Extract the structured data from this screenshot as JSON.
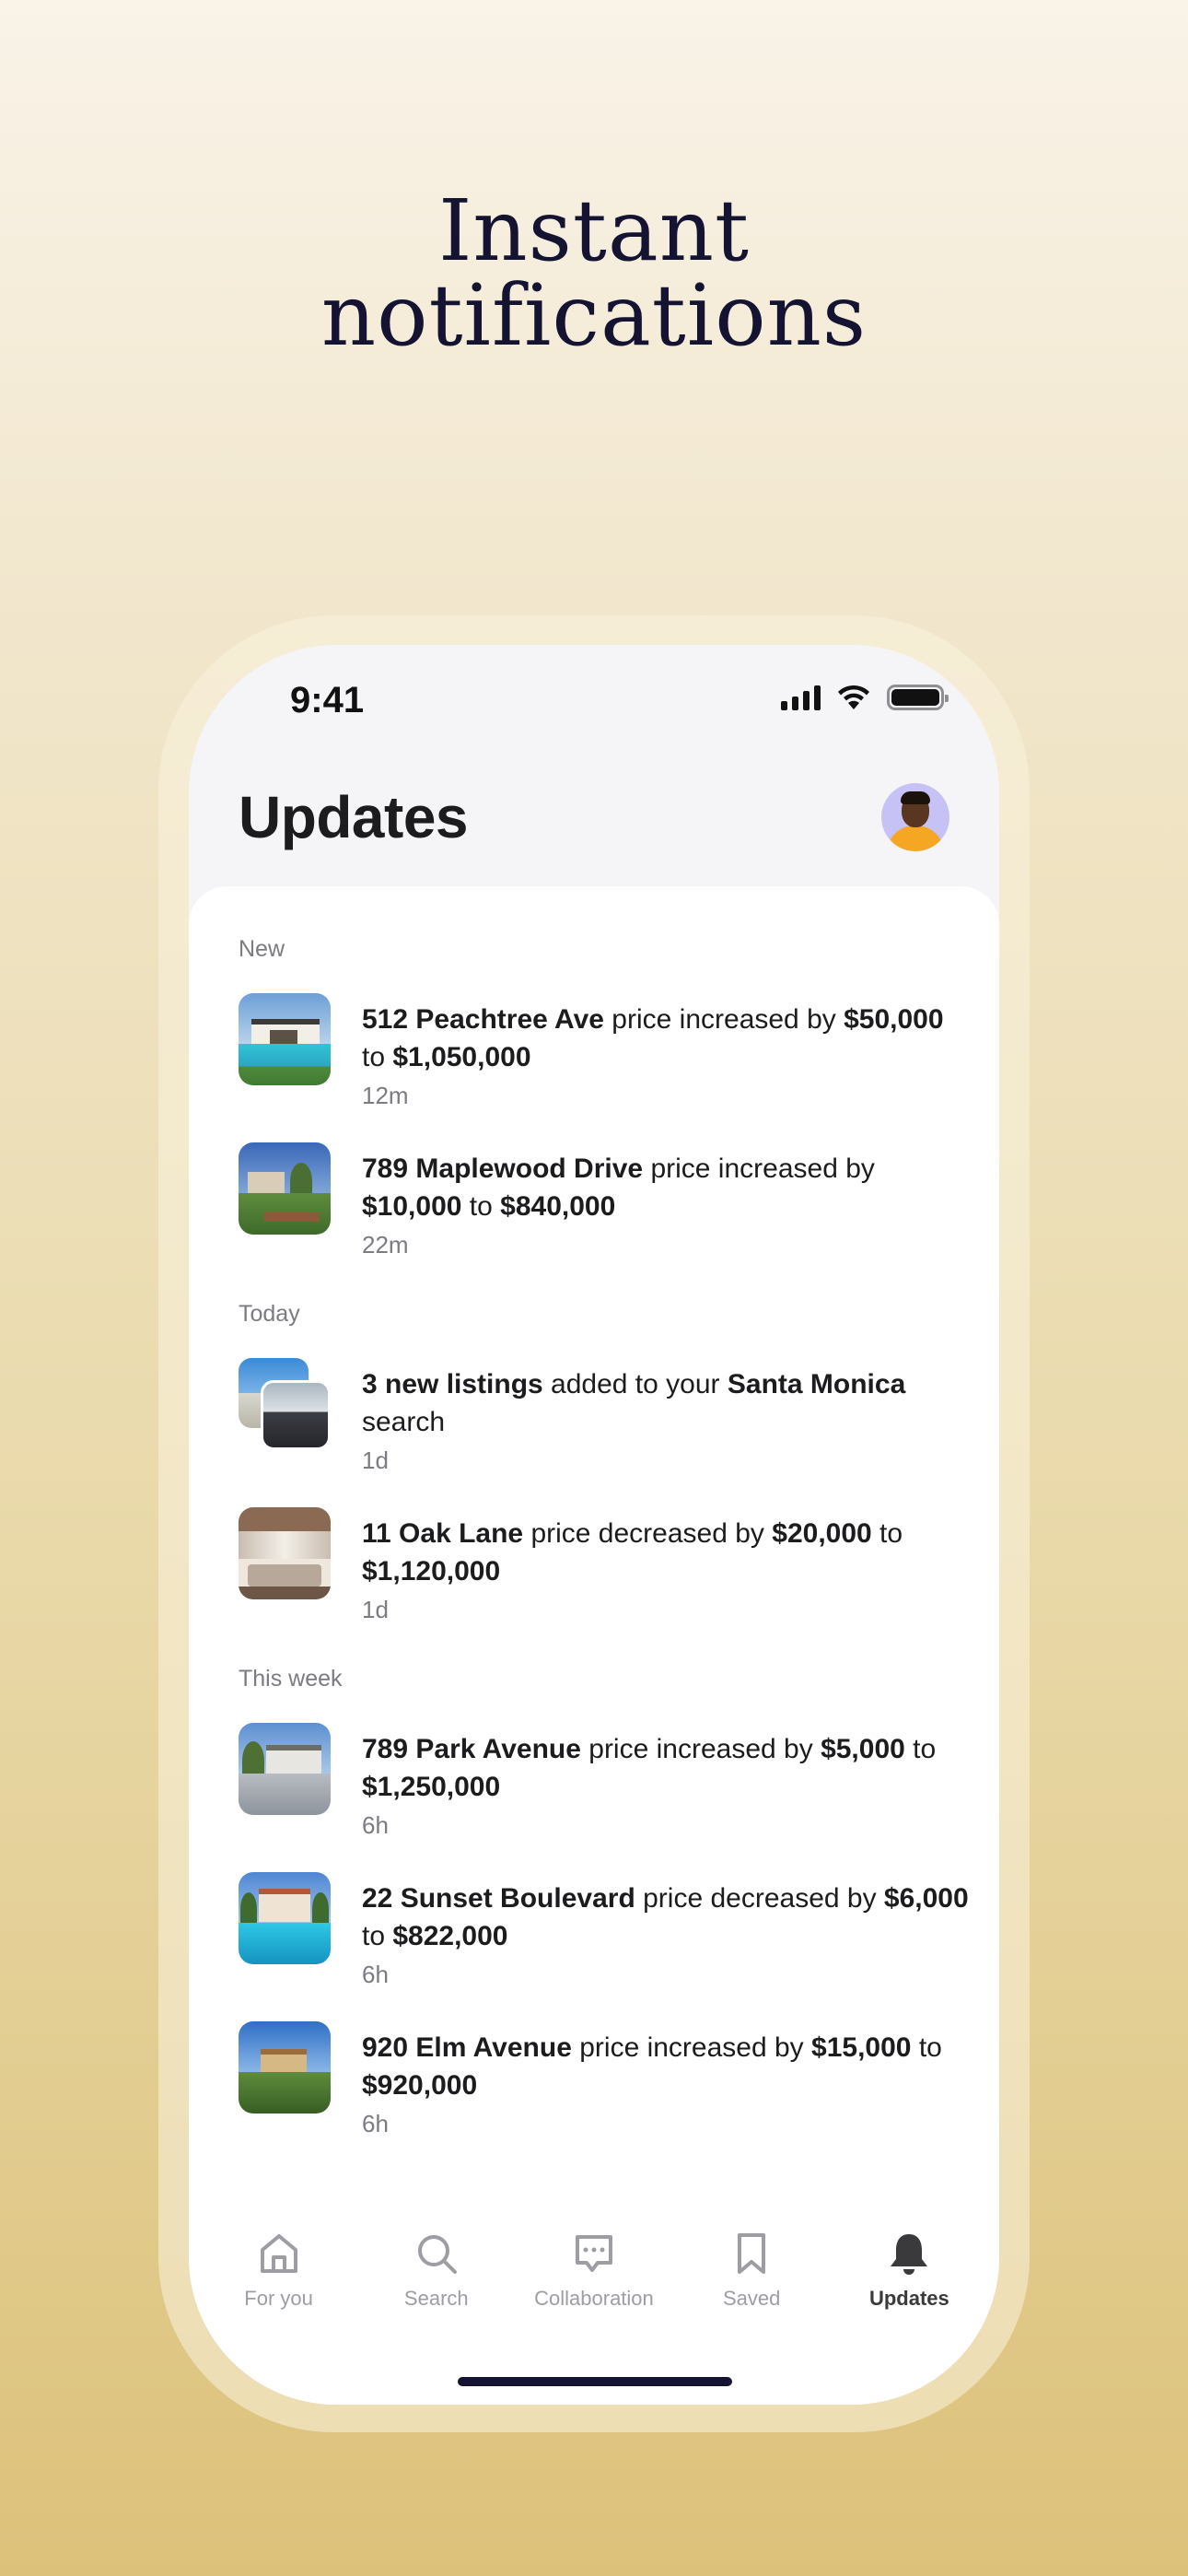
{
  "headline": {
    "line1": "Instant",
    "line2": "notifications"
  },
  "status_bar": {
    "time": "9:41"
  },
  "header": {
    "title": "Updates"
  },
  "sections": [
    {
      "label": "New",
      "items": [
        {
          "bold1": "512 Peachtree Ave",
          "text1": " price increased by ",
          "bold2": "$50,000",
          "text2": " to ",
          "bold3": "$1,050,000",
          "text3": "",
          "time": "12m",
          "thumb": "modern-house-pool"
        },
        {
          "bold1": "789 Maplewood Drive",
          "text1": " price increased by ",
          "bold2": "$10,000",
          "text2": " to ",
          "bold3": "$840,000",
          "text3": "",
          "time": "22m",
          "thumb": "garden-house"
        }
      ]
    },
    {
      "label": "Today",
      "items": [
        {
          "bold1": "3 new listings",
          "text1": " added to your ",
          "bold2": "Santa Monica",
          "text2": " search",
          "bold3": "",
          "text3": "",
          "time": "1d",
          "thumb": "multiple-listings"
        },
        {
          "bold1": "11 Oak Lane",
          "text1": " price decreased by ",
          "bold2": "$20,000",
          "text2": " to ",
          "bold3": "$1,120,000",
          "text3": "",
          "time": "1d",
          "thumb": "interior-living-room"
        }
      ]
    },
    {
      "label": "This week",
      "items": [
        {
          "bold1": "789 Park Avenue",
          "text1": " price increased by ",
          "bold2": "$5,000",
          "text2": " to ",
          "bold3": "$1,250,000",
          "text3": "",
          "time": "6h",
          "thumb": "driveway-house"
        },
        {
          "bold1": "22 Sunset Boulevard",
          "text1": " price decreased by ",
          "bold2": "$6,000",
          "text2": " to ",
          "bold3": "$822,000",
          "text3": "",
          "time": "6h",
          "thumb": "villa-pool"
        },
        {
          "bold1": "920 Elm Avenue",
          "text1": " price increased by ",
          "bold2": "$15,000",
          "text2": " to ",
          "bold3": "$920,000",
          "text3": "",
          "time": "6h",
          "thumb": "hillside-mansion"
        }
      ]
    }
  ],
  "tabbar": {
    "tabs": [
      {
        "label": "For you",
        "icon": "home-icon",
        "active": false
      },
      {
        "label": "Search",
        "icon": "search-icon",
        "active": false
      },
      {
        "label": "Collaboration",
        "icon": "chat-bubble-icon",
        "active": false
      },
      {
        "label": "Saved",
        "icon": "bookmark-icon",
        "active": false
      },
      {
        "label": "Updates",
        "icon": "bell-icon",
        "active": true
      }
    ]
  },
  "colors": {
    "headline": "#141432",
    "text": "#1c1c1e",
    "secondary": "#7b7b82",
    "tab_inactive": "#9d9da3",
    "tab_active": "#3a3a3c"
  }
}
